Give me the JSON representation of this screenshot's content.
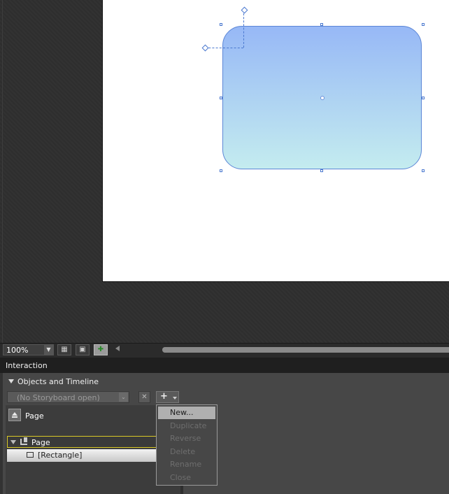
{
  "zoom": {
    "value": "100%"
  },
  "panel": {
    "header": "Interaction",
    "section_title": "Objects and Timeline"
  },
  "storyboard": {
    "placeholder": "(No Storyboard open)"
  },
  "scope": {
    "label": "Page"
  },
  "tree": [
    {
      "label": "Page",
      "icon": "page-element-icon"
    },
    {
      "label": "[Rectangle]",
      "icon": "rectangle-icon"
    }
  ],
  "storyboard_menu": [
    {
      "label": "New...",
      "enabled": true
    },
    {
      "label": "Duplicate",
      "enabled": false
    },
    {
      "label": "Reverse",
      "enabled": false
    },
    {
      "label": "Delete",
      "enabled": false
    },
    {
      "label": "Rename",
      "enabled": false
    },
    {
      "label": "Close",
      "enabled": false
    }
  ],
  "colors": {
    "selection": "#4a78cf",
    "gradient_top": "#97b8f6",
    "gradient_bottom": "#c4ecef",
    "active_row_border": "#d9c826"
  }
}
